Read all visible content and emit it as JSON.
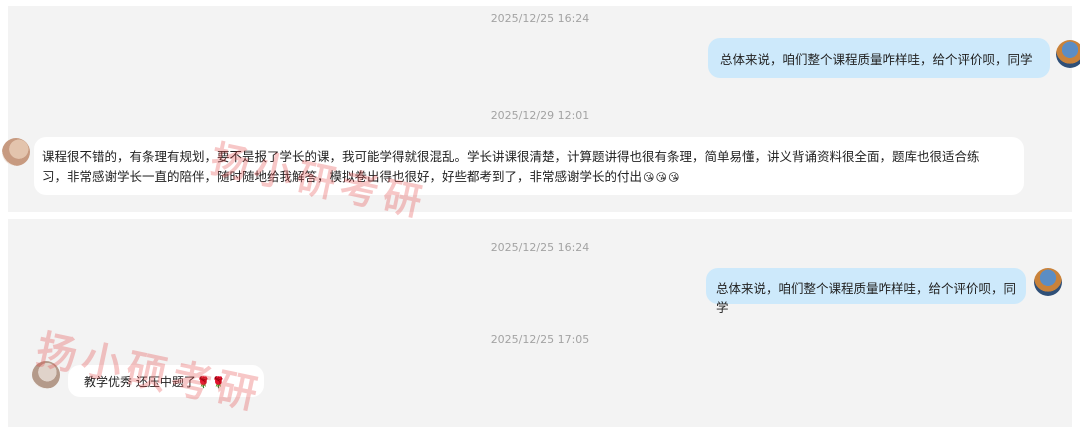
{
  "panel1": {
    "timestamp_1": "2025/12/25 16:24",
    "outgoing_message": "总体来说，咱们整个课程质量咋样哇，给个评价呗，同学",
    "timestamp_2": "2025/12/29 12:01",
    "incoming_message_line1": "课程很不错的，有条理有规划，要不是报了学长的课，我可能学得就很混乱。学长讲课很清楚，计算题讲得也很有条理，简单易懂，讲义背诵资料很全面，题库也很适合练",
    "incoming_message_line2": "习，非常感谢学长一直的陪伴，随时随地给我解答，模拟卷出得也很好，好些都考到了，非常感谢学长的付出",
    "incoming_emojis": [
      "😘",
      "😘",
      "😘"
    ]
  },
  "panel2": {
    "timestamp_1": "2025/12/25 16:24",
    "outgoing_message": "总体来说，咱们整个课程质量咋样哇，给个评价呗，同学",
    "timestamp_2": "2025/12/25 17:05",
    "incoming_message": "教学优秀  还压中题了",
    "incoming_emojis": [
      "🌹",
      "🌹"
    ]
  },
  "watermark": {
    "text_1": "扬小研考研",
    "text_2": "扬小硕考研"
  }
}
